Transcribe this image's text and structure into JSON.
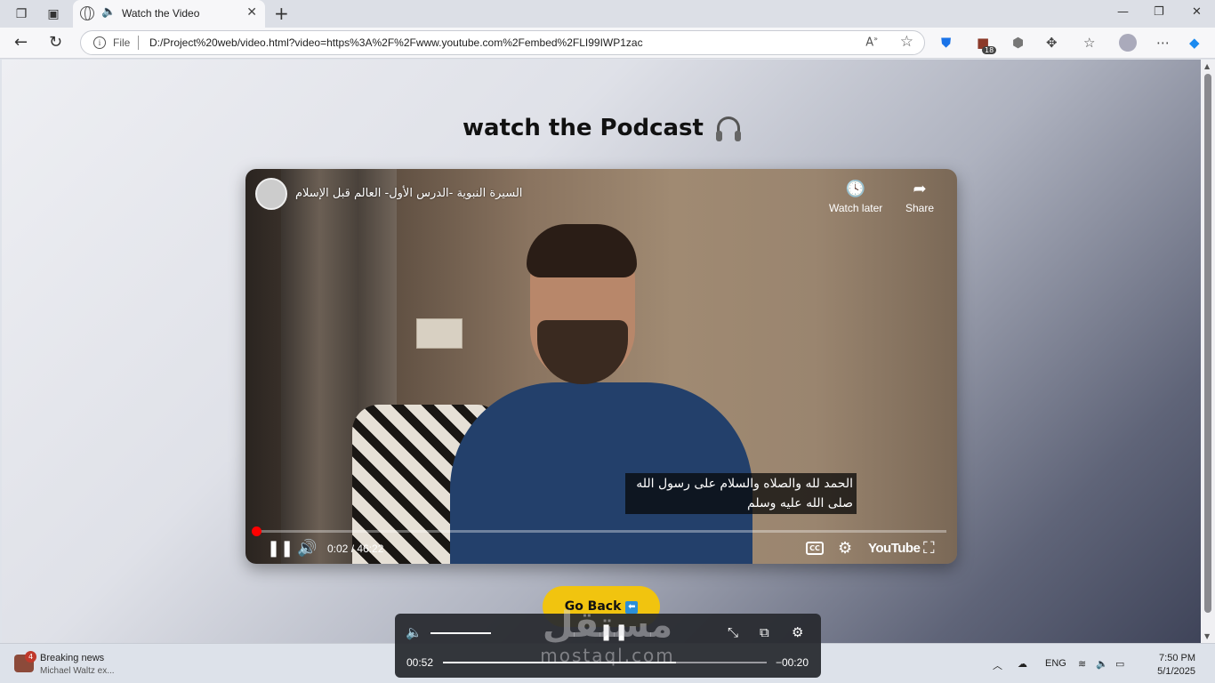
{
  "browser": {
    "tab": {
      "title": "Watch the Video"
    },
    "address": {
      "scheme_label": "File",
      "url": "D:/Project%20web/video.html?video=https%3A%2F%2Fwww.youtube.com%2Fembed%2FLI99IWP1zac"
    },
    "extension_badge": "18"
  },
  "page": {
    "title": "watch the Podcast",
    "go_back_label": "Go Back"
  },
  "video": {
    "title": "السيرة النبوية -الدرس الأول- العالم قبل الإسلام",
    "watch_later_label": "Watch later",
    "share_label": "Share",
    "caption_line1": "الحمد لله والصلاه والسلام على رسول الله",
    "caption_line2": "صلى الله عليه وسلم",
    "time_display": "0:02 / 46:22",
    "logo_text": "YouTube",
    "cc_label": "CC"
  },
  "mini_player": {
    "current_time": "00:52",
    "remaining_time": "−00:20",
    "progress": 0.72
  },
  "watermark": {
    "arabic": "مستقل",
    "latin": "mostaql.com"
  },
  "taskbar": {
    "news_title": "Breaking news",
    "news_subtitle": "Michael Waltz ex...",
    "news_badge": "4",
    "language": "ENG",
    "time": "7:50 PM",
    "date": "5/1/2025"
  }
}
